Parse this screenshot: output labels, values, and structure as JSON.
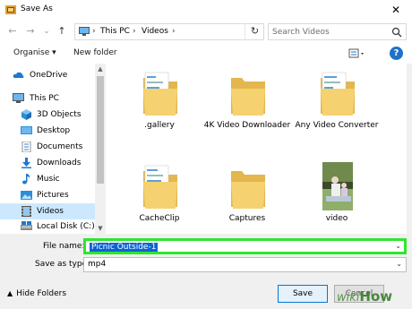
{
  "window": {
    "title": "Save As",
    "close_label": "✕"
  },
  "nav": {
    "back": "←",
    "forward": "→",
    "recent": "⌄",
    "up": "↑",
    "breadcrumb": [
      "This PC",
      "Videos"
    ],
    "separator": "›",
    "refresh": "↻"
  },
  "search": {
    "placeholder": "Search Videos"
  },
  "toolbar": {
    "organise_label": "Organise ▾",
    "new_folder_label": "New folder",
    "help_label": "?"
  },
  "sidebar": {
    "items": [
      {
        "label": "OneDrive",
        "icon": "cloud-icon"
      },
      {
        "label": "This PC",
        "icon": "computer-icon"
      },
      {
        "label": "3D Objects",
        "icon": "cube-icon"
      },
      {
        "label": "Desktop",
        "icon": "desktop-icon"
      },
      {
        "label": "Documents",
        "icon": "documents-icon"
      },
      {
        "label": "Downloads",
        "icon": "download-icon"
      },
      {
        "label": "Music",
        "icon": "music-icon"
      },
      {
        "label": "Pictures",
        "icon": "pictures-icon"
      },
      {
        "label": "Videos",
        "icon": "videos-icon",
        "selected": true
      },
      {
        "label": "Local Disk (C:)",
        "icon": "disk-icon"
      }
    ]
  },
  "files": [
    {
      "label": ".gallery",
      "type": "folder-with-docs"
    },
    {
      "label": "4K Video Downloader",
      "type": "folder"
    },
    {
      "label": "Any Video Converter",
      "type": "folder-with-docs"
    },
    {
      "label": "CacheClip",
      "type": "folder-with-docs"
    },
    {
      "label": "Captures",
      "type": "folder"
    },
    {
      "label": "video",
      "type": "video-thumbnail"
    }
  ],
  "form": {
    "file_name_label": "File name:",
    "file_name_value": "Picnic Outside-1",
    "save_type_label": "Save as type:",
    "save_type_value": "mp4",
    "hide_folders_label": "Hide Folders",
    "save_label": "Save",
    "cancel_label": "Cancel"
  },
  "colors": {
    "selection": "#0a64d2",
    "highlight_border": "#2ee62e",
    "nav_selected": "#cce8ff",
    "folder": "#f3cd6a"
  },
  "watermark": {
    "part1": "wiki",
    "part2": "How"
  }
}
